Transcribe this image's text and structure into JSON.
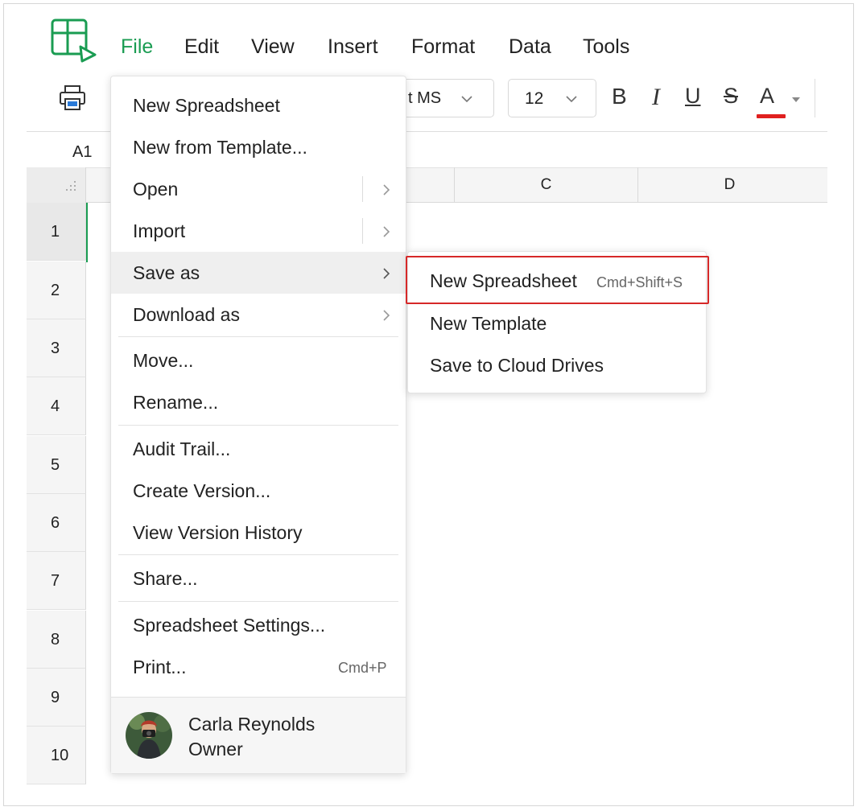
{
  "menubar": {
    "items": [
      "File",
      "Edit",
      "View",
      "Insert",
      "Format",
      "Data",
      "Tools"
    ],
    "active": "File"
  },
  "toolbar": {
    "font_name": "t MS",
    "font_size": "12",
    "bold": "B",
    "italic": "I",
    "underline": "U",
    "strike": "S",
    "text_color": "A",
    "text_color_value": "#e0201f"
  },
  "cell_reference": "A1",
  "columns": [
    "C",
    "D"
  ],
  "rows": [
    "1",
    "2",
    "3",
    "4",
    "5",
    "6",
    "7",
    "8",
    "9",
    "10"
  ],
  "file_menu": {
    "items": [
      {
        "label": "New Spreadsheet"
      },
      {
        "label": "New from Template..."
      },
      {
        "label": "Open",
        "submenu": true
      },
      {
        "label": "Import",
        "submenu": true
      },
      {
        "label": "Save as",
        "submenu": true,
        "hovered": true
      },
      {
        "label": "Download as",
        "submenu": true
      },
      {
        "label": "Move..."
      },
      {
        "label": "Rename..."
      },
      {
        "label": "Audit Trail..."
      },
      {
        "label": "Create Version..."
      },
      {
        "label": "View Version History"
      },
      {
        "label": "Share..."
      },
      {
        "label": "Spreadsheet Settings..."
      },
      {
        "label": "Print...",
        "shortcut": "Cmd+P"
      }
    ],
    "user": {
      "name": "Carla Reynolds",
      "role": "Owner"
    }
  },
  "save_as_submenu": {
    "items": [
      {
        "label": "New Spreadsheet",
        "shortcut": "Cmd+Shift+S",
        "highlighted": true
      },
      {
        "label": "New Template"
      },
      {
        "label": "Save to Cloud Drives"
      }
    ]
  },
  "colors": {
    "accent": "#1a9c52",
    "highlight_border": "#d62828"
  }
}
